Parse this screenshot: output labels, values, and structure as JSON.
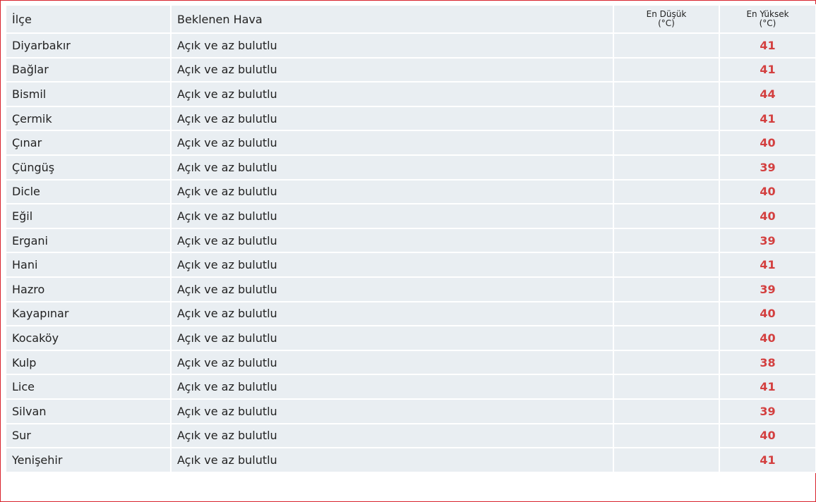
{
  "header": {
    "district": "İlçe",
    "forecast": "Beklenen Hava",
    "min_line1": "En Düşük",
    "min_line2": "(°C)",
    "max_line1": "En Yüksek",
    "max_line2": "(°C)"
  },
  "accent_color": "#d33f3f",
  "rows": [
    {
      "district": "Diyarbakır",
      "forecast": "Açık ve az bulutlu",
      "min": "",
      "max": "41"
    },
    {
      "district": "Bağlar",
      "forecast": "Açık ve az bulutlu",
      "min": "",
      "max": "41"
    },
    {
      "district": "Bismil",
      "forecast": "Açık ve az bulutlu",
      "min": "",
      "max": "44"
    },
    {
      "district": "Çermik",
      "forecast": "Açık ve az bulutlu",
      "min": "",
      "max": "41"
    },
    {
      "district": "Çınar",
      "forecast": "Açık ve az bulutlu",
      "min": "",
      "max": "40"
    },
    {
      "district": "Çüngüş",
      "forecast": "Açık ve az bulutlu",
      "min": "",
      "max": "39"
    },
    {
      "district": "Dicle",
      "forecast": "Açık ve az bulutlu",
      "min": "",
      "max": "40"
    },
    {
      "district": "Eğil",
      "forecast": "Açık ve az bulutlu",
      "min": "",
      "max": "40"
    },
    {
      "district": "Ergani",
      "forecast": "Açık ve az bulutlu",
      "min": "",
      "max": "39"
    },
    {
      "district": "Hani",
      "forecast": "Açık ve az bulutlu",
      "min": "",
      "max": "41"
    },
    {
      "district": "Hazro",
      "forecast": "Açık ve az bulutlu",
      "min": "",
      "max": "39"
    },
    {
      "district": "Kayapınar",
      "forecast": "Açık ve az bulutlu",
      "min": "",
      "max": "40"
    },
    {
      "district": "Kocaköy",
      "forecast": "Açık ve az bulutlu",
      "min": "",
      "max": "40"
    },
    {
      "district": "Kulp",
      "forecast": "Açık ve az bulutlu",
      "min": "",
      "max": "38"
    },
    {
      "district": "Lice",
      "forecast": "Açık ve az bulutlu",
      "min": "",
      "max": "41"
    },
    {
      "district": "Silvan",
      "forecast": "Açık ve az bulutlu",
      "min": "",
      "max": "39"
    },
    {
      "district": "Sur",
      "forecast": "Açık ve az bulutlu",
      "min": "",
      "max": "40"
    },
    {
      "district": "Yenişehir",
      "forecast": "Açık ve az bulutlu",
      "min": "",
      "max": "41"
    }
  ]
}
